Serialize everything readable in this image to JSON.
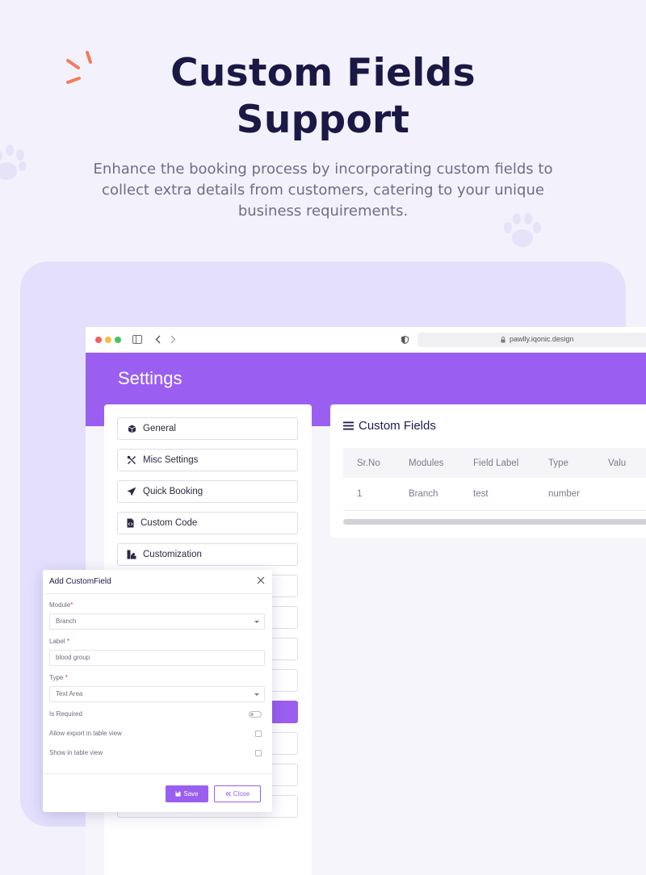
{
  "hero": {
    "title_line1": "Custom Fields",
    "title_line2": "Support",
    "subtitle": "Enhance the booking process by incorporating custom fields to collect extra details from customers, catering to your unique business requirements."
  },
  "colors": {
    "brand": "#9a5ff0",
    "accent_spark": "#f47b5c",
    "title": "#1a1845",
    "stage": "#e3dffd"
  },
  "browser": {
    "url": "pawlly.iqonic.design"
  },
  "settings": {
    "page_title": "Settings",
    "menu": [
      {
        "label": "General",
        "icon": "cube-icon"
      },
      {
        "label": "Misc Settings",
        "icon": "tools-icon"
      },
      {
        "label": "Quick Booking",
        "icon": "paper-plane-icon"
      },
      {
        "label": "Custom Code",
        "icon": "code-file-icon"
      },
      {
        "label": "Customization",
        "icon": "palette-icon"
      }
    ]
  },
  "custom_fields": {
    "title": "Custom Fields",
    "columns": [
      "Sr.No",
      "Modules",
      "Field Label",
      "Type",
      "Valu"
    ],
    "rows": [
      [
        "1",
        "Branch",
        "test",
        "number",
        ""
      ]
    ]
  },
  "modal": {
    "title": "Add CustomField",
    "module_label": "Module",
    "module_value": "Branch",
    "label_label": "Label",
    "label_placeholder": "blood group",
    "type_label": "Type",
    "type_value": "Text Area",
    "is_required_label": "Is Required",
    "is_required": false,
    "allow_export_label": "Allow export in table view",
    "allow_export": false,
    "show_in_table_label": "Show in table view",
    "show_in_table": false,
    "save_label": "Save",
    "close_label": "Close",
    "required_mark": "*"
  }
}
